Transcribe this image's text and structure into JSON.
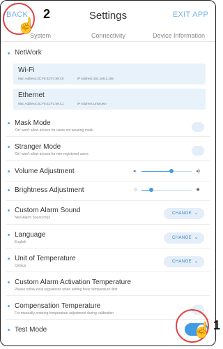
{
  "header": {
    "back_label": "BACK",
    "title": "Settings",
    "exit_label": "EXIT APP"
  },
  "tabs": [
    "System",
    "Connectivity",
    "Device Information"
  ],
  "network": {
    "label": "NetWork",
    "wifi": {
      "name": "Wi-Fi",
      "mac": "Mac Address:3C:F8:02:F1:59:C0",
      "ip": "IP Address:192.168.2.158"
    },
    "ethernet": {
      "name": "Ethernet",
      "mac": "Mac Address:3C:F8:02:F1:59:C1",
      "ip": "IP Address:Unknown"
    }
  },
  "settings": {
    "mask_mode": {
      "label": "Mask Mode",
      "sub": "'On' won't allow access for users not wearing mask",
      "on": false
    },
    "stranger_mode": {
      "label": "Stranger Mode",
      "sub": "'On' won't allow access for non-registered users",
      "on": false
    },
    "volume": {
      "label": "Volume Adjustment",
      "value": 0.6
    },
    "brightness": {
      "label": "Brightness Adjustment",
      "value": 0.2
    },
    "alarm_sound": {
      "label": "Custom Alarm Sound",
      "sub": "New Alarm Sound.mp3",
      "button": "CHANGE"
    },
    "language": {
      "label": "Language",
      "sub": "English",
      "button": "CHANGE"
    },
    "temp_unit": {
      "label": "Unit of Temperature",
      "sub": "Celsius",
      "button": "CHANGE"
    },
    "alarm_temp": {
      "label": "Custom Alarm Activation Temperature",
      "sub": "Please follow local regulations when setting fever temperature limit"
    },
    "compensation": {
      "label": "Compensation Temperature",
      "sub": "For manually entering temperature adjustment during calibration",
      "on": false
    },
    "test_mode": {
      "label": "Test Mode",
      "on": true
    }
  },
  "annotations": {
    "step_1": "1",
    "step_2": "2"
  },
  "colors": {
    "accent": "#3f9be3",
    "link": "#6fb3e8",
    "card_bg": "#e8f2fb",
    "annotation": "#e04545"
  }
}
